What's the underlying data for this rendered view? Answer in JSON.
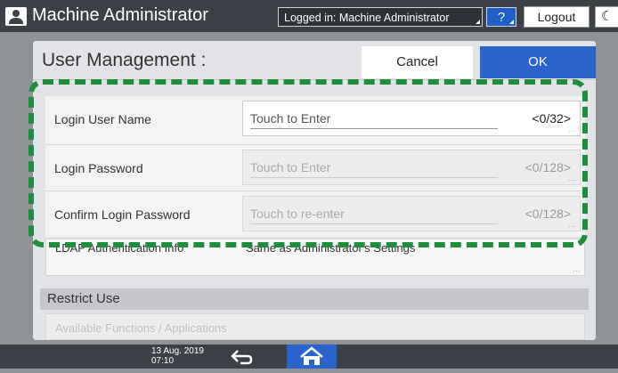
{
  "header": {
    "app_title": "Machine Administrator",
    "logged_in": "Logged in: Machine Administrator",
    "help_label": "?",
    "logout_label": "Logout",
    "moon_glyph": "☾"
  },
  "dialog": {
    "title": "User Management :",
    "cancel_label": "Cancel",
    "ok_label": "OK",
    "fields": [
      {
        "label": "Login User Name",
        "placeholder": "Touch to Enter",
        "count": "<0/32>",
        "enabled": true
      },
      {
        "label": "Login Password",
        "placeholder": "Touch to Enter",
        "count": "<0/128>",
        "enabled": false
      },
      {
        "label": "Confirm Login Password",
        "placeholder": "Touch to re-enter",
        "count": "<0/128>",
        "enabled": false
      }
    ],
    "ldap_row": {
      "label": "LDAP Authentication Info",
      "value": "Same as Administrator's Settings"
    },
    "section": {
      "title": "Restrict Use",
      "faded_item": "Available Functions / Applications"
    }
  },
  "footer": {
    "date": "13 Aug. 2019",
    "time": "07:10"
  },
  "icons": {
    "user": "user-icon",
    "back": "back-arrow-icon",
    "home": "home-icon"
  },
  "colors": {
    "accent_blue": "#2a63c9",
    "highlight_green": "#1f8e3c",
    "top_bar": "#3c4047"
  }
}
